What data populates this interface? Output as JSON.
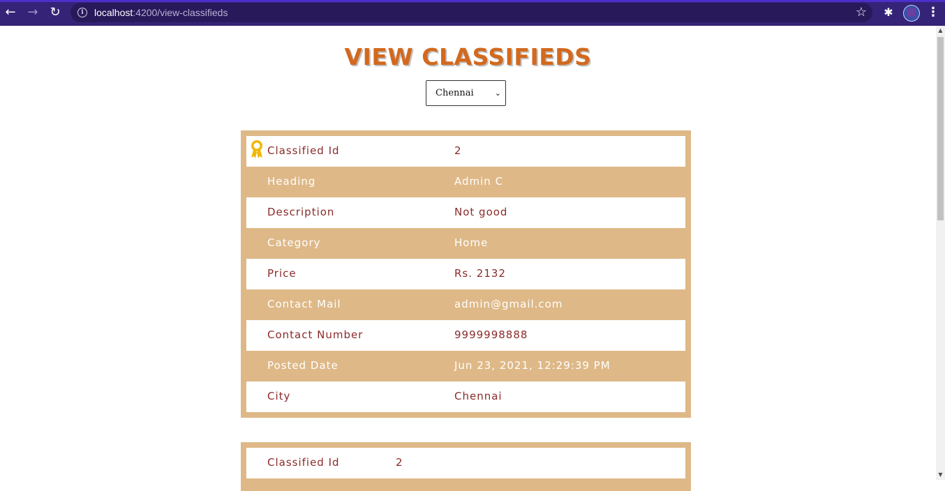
{
  "browser": {
    "url_host": "localhost",
    "url_path": ":4200/view-classifieds"
  },
  "page": {
    "title": "VIEW CLASSIFIEDS",
    "city_select": {
      "value": "Chennai"
    }
  },
  "classifieds": [
    {
      "featured": true,
      "rows": [
        {
          "label": "Classified Id",
          "value": "2"
        },
        {
          "label": "Heading",
          "value": "Admin C"
        },
        {
          "label": "Description",
          "value": "Not good"
        },
        {
          "label": "Category",
          "value": "Home"
        },
        {
          "label": "Price",
          "value": "Rs. 2132"
        },
        {
          "label": "Contact Mail",
          "value": "admin@gmail.com"
        },
        {
          "label": "Contact Number",
          "value": "9999998888"
        },
        {
          "label": "Posted Date",
          "value": "Jun 23, 2021, 12:29:39 PM"
        },
        {
          "label": "City",
          "value": "Chennai"
        }
      ]
    },
    {
      "featured": false,
      "rows": [
        {
          "label": "Classified Id",
          "value": "2"
        }
      ]
    }
  ],
  "icons": {
    "featured": "award-ribbon-icon"
  },
  "colors": {
    "title": "#d2691e",
    "card_bg": "#deb887",
    "row_text": "#8b2a2a",
    "chrome": "#352377"
  }
}
